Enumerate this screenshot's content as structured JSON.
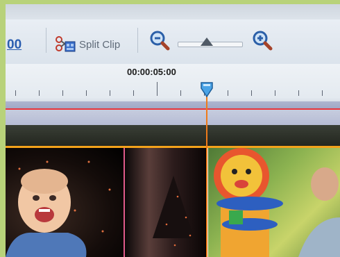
{
  "toolbar": {
    "timecode_left": "00",
    "split_clip_label": "Split Clip",
    "zoom_level": 0.46
  },
  "ruler": {
    "current_timecode": "00:00:05:00"
  },
  "playhead": {
    "time": "00:00:05:00"
  },
  "timeline": {
    "clips": [
      {
        "name": "clip-baby"
      },
      {
        "name": "clip-dark"
      },
      {
        "name": "clip-toy"
      }
    ]
  },
  "colors": {
    "accent_blue": "#2a5db0",
    "playhead": "#ef7b1a",
    "red_marker": "#e8343a",
    "clip_border": "#f3a21b"
  }
}
